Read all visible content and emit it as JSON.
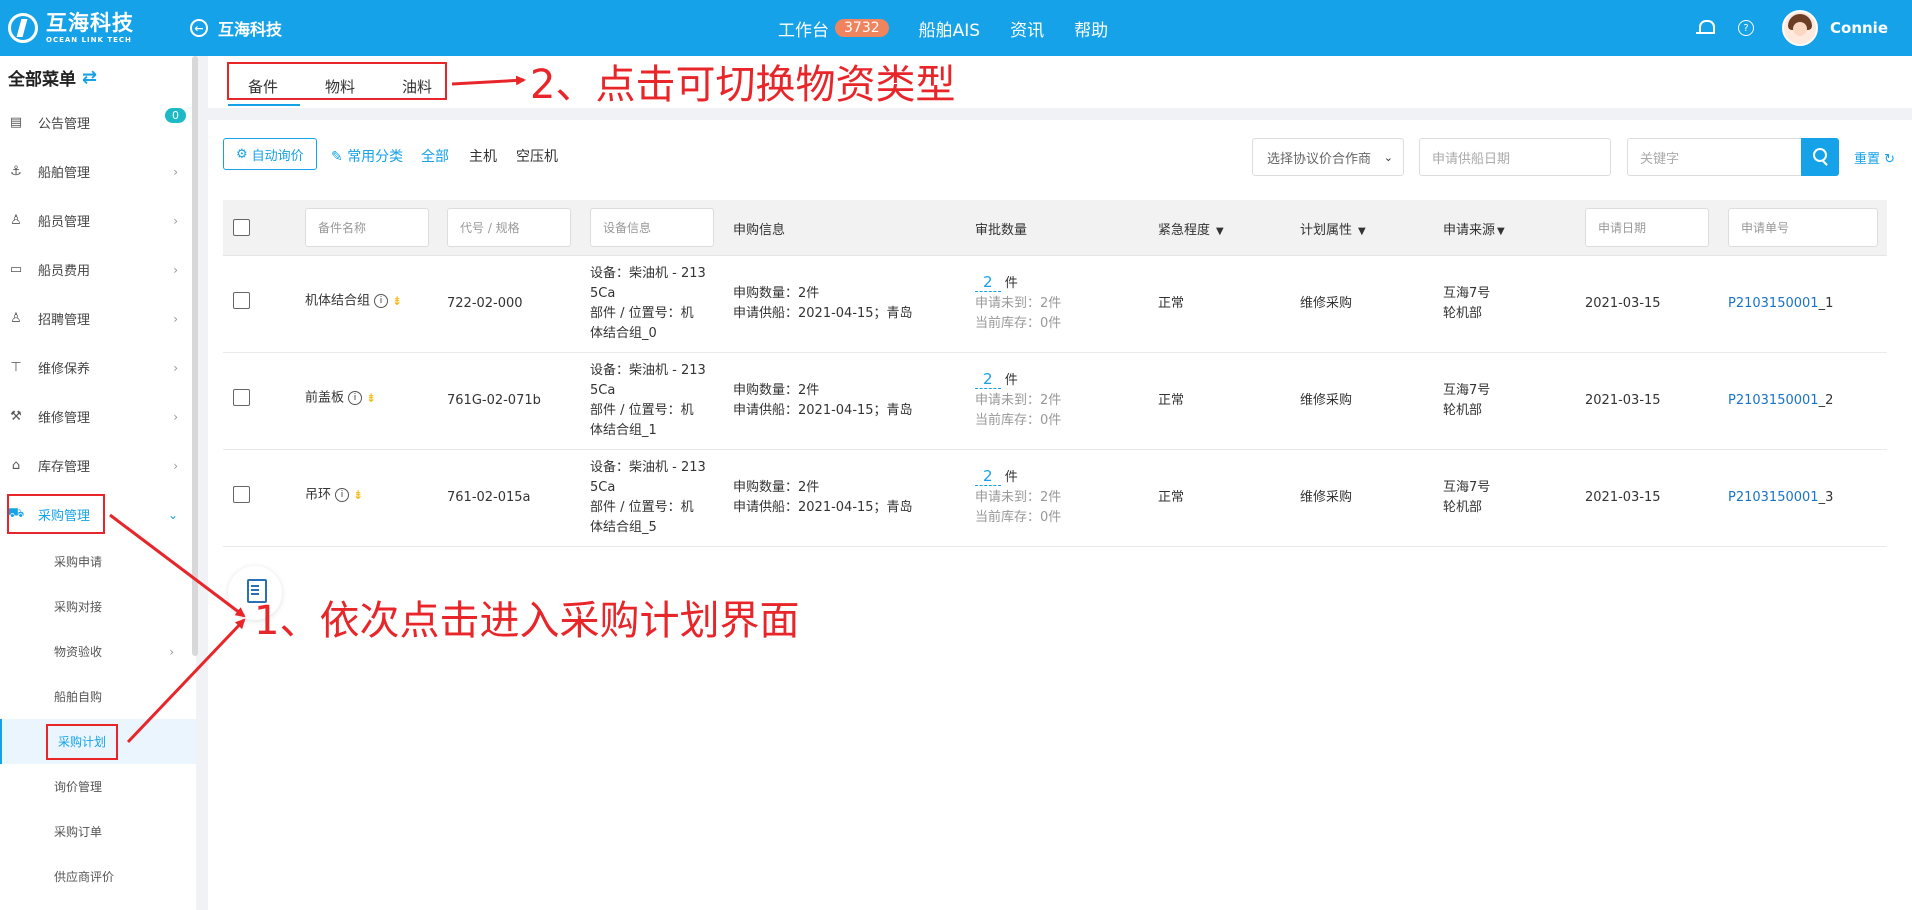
{
  "header": {
    "logo_cn": "互海科技",
    "logo_en": "OCEAN LINK TECH",
    "back_title": "互海科技",
    "nav": [
      {
        "label": "工作台",
        "badge": "3732"
      },
      {
        "label": "船舶AIS"
      },
      {
        "label": "资讯"
      },
      {
        "label": "帮助"
      }
    ],
    "username": "Connie"
  },
  "sidebar": {
    "title": "全部菜单",
    "items": [
      {
        "label": "公告管理",
        "icon": "book-icon",
        "badge": "0"
      },
      {
        "label": "船舶管理",
        "icon": "anchor-icon"
      },
      {
        "label": "船员管理",
        "icon": "user-icon"
      },
      {
        "label": "船员费用",
        "icon": "wallet-icon"
      },
      {
        "label": "招聘管理",
        "icon": "user-search-icon"
      },
      {
        "label": "维修保养",
        "icon": "brush-icon"
      },
      {
        "label": "维修管理",
        "icon": "wrench-icon"
      },
      {
        "label": "库存管理",
        "icon": "home-icon"
      },
      {
        "label": "采购管理",
        "icon": "cart-icon"
      }
    ],
    "subitems": [
      {
        "label": "采购申请"
      },
      {
        "label": "采购对接"
      },
      {
        "label": "物资验收"
      },
      {
        "label": "船舶自购"
      },
      {
        "label": "采购计划"
      },
      {
        "label": "询价管理"
      },
      {
        "label": "采购订单"
      },
      {
        "label": "供应商评价"
      }
    ]
  },
  "tabs": [
    "备件",
    "物料",
    "油料"
  ],
  "filters": {
    "auto_inquiry": "自动询价",
    "common_category": "常用分类",
    "categories": [
      "全部",
      "主机",
      "空压机"
    ],
    "partner_select": "选择协议价合作商",
    "date_placeholder": "申请供船日期",
    "keyword_placeholder": "关键字",
    "reset": "重置"
  },
  "table": {
    "headers": {
      "part_name": "备件名称",
      "code_spec": "代号 / 规格",
      "equipment": "设备信息",
      "purchase_info": "申购信息",
      "approve_qty": "审批数量",
      "urgency": "紧急程度",
      "plan_attr": "计划属性",
      "source": "申请来源",
      "apply_date": "申请日期",
      "apply_no": "申请单号"
    },
    "rows": [
      {
        "name": "机体结合组",
        "code": "722-02-000",
        "equip_line1": "设备：柴油机 - 213",
        "equip_line2": "5Ca",
        "equip_line3": "部件 / 位置号：机",
        "equip_line4": "体结合组_0",
        "purchase_qty": "申购数量：2件",
        "purchase_supply": "申请供船：2021-04-15；青岛",
        "approve_num": "2",
        "approve_unit": "件",
        "not_arrived": "申请未到：2件",
        "stock": "当前库存：0件",
        "urgency": "正常",
        "plan": "维修采购",
        "source_line1": "互海7号",
        "source_line2": "轮机部",
        "date": "2021-03-15",
        "no_link": "P2103150001",
        "no_suffix": "_1"
      },
      {
        "name": "前盖板",
        "code": "761G-02-071b",
        "equip_line1": "设备：柴油机 - 213",
        "equip_line2": "5Ca",
        "equip_line3": "部件 / 位置号：机",
        "equip_line4": "体结合组_1",
        "purchase_qty": "申购数量：2件",
        "purchase_supply": "申请供船：2021-04-15；青岛",
        "approve_num": "2",
        "approve_unit": "件",
        "not_arrived": "申请未到：2件",
        "stock": "当前库存：0件",
        "urgency": "正常",
        "plan": "维修采购",
        "source_line1": "互海7号",
        "source_line2": "轮机部",
        "date": "2021-03-15",
        "no_link": "P2103150001",
        "no_suffix": "_2"
      },
      {
        "name": "吊环",
        "code": "761-02-015a",
        "equip_line1": "设备：柴油机 - 213",
        "equip_line2": "5Ca",
        "equip_line3": "部件 / 位置号：机",
        "equip_line4": "体结合组_5",
        "purchase_qty": "申购数量：2件",
        "purchase_supply": "申请供船：2021-04-15；青岛",
        "approve_num": "2",
        "approve_unit": "件",
        "not_arrived": "申请未到：2件",
        "stock": "当前库存：0件",
        "urgency": "正常",
        "plan": "维修采购",
        "source_line1": "互海7号",
        "source_line2": "轮机部",
        "date": "2021-03-15",
        "no_link": "P2103150001",
        "no_suffix": "_3"
      }
    ]
  },
  "annotations": {
    "step1": "1、依次点击进入采购计划界面",
    "step2": "2、点击可切换物资类型",
    "color": "#e8262a"
  },
  "colors": {
    "primary": "#16a2e8",
    "badge": "#f0845f",
    "count_badge": "#1cbac7"
  }
}
